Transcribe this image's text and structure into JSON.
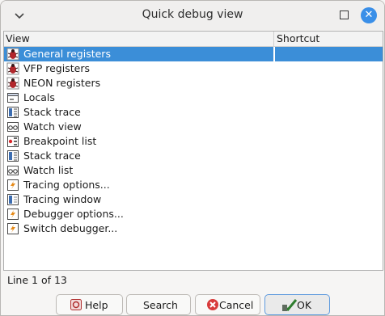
{
  "window": {
    "title": "Quick debug view",
    "menu_icon": "chevron-down-icon",
    "maximize_icon": "maximize-icon",
    "close_icon": "close-icon"
  },
  "table": {
    "columns": [
      "View",
      "Shortcut"
    ],
    "rows": [
      {
        "label": "General registers",
        "icon": "bug-icon",
        "selected": true
      },
      {
        "label": "VFP registers",
        "icon": "bug-icon"
      },
      {
        "label": "NEON registers",
        "icon": "bug-icon"
      },
      {
        "label": "Locals",
        "icon": "locals-window-icon"
      },
      {
        "label": "Stack trace",
        "icon": "stack-icon"
      },
      {
        "label": "Watch view",
        "icon": "glasses-icon"
      },
      {
        "label": "Breakpoint list",
        "icon": "breakpoint-list-icon"
      },
      {
        "label": "Stack trace",
        "icon": "stack-icon"
      },
      {
        "label": "Watch list",
        "icon": "glasses-icon"
      },
      {
        "label": "Tracing options...",
        "icon": "tracing-options-icon"
      },
      {
        "label": "Tracing window",
        "icon": "tracing-window-icon"
      },
      {
        "label": "Debugger options...",
        "icon": "tracing-options-icon"
      },
      {
        "label": "Switch debugger...",
        "icon": "tracing-options-icon"
      }
    ]
  },
  "status": "Line 1 of 13",
  "buttons": {
    "help": {
      "label": "Help",
      "icon": "help-icon"
    },
    "search": {
      "label": "Search"
    },
    "cancel": {
      "label": "Cancel",
      "icon": "cancel-icon"
    },
    "ok": {
      "label": "OK",
      "icon": "ok-check-icon"
    }
  },
  "colors": {
    "selection": "#3b8ed8",
    "close_button": "#3a8fe8"
  }
}
